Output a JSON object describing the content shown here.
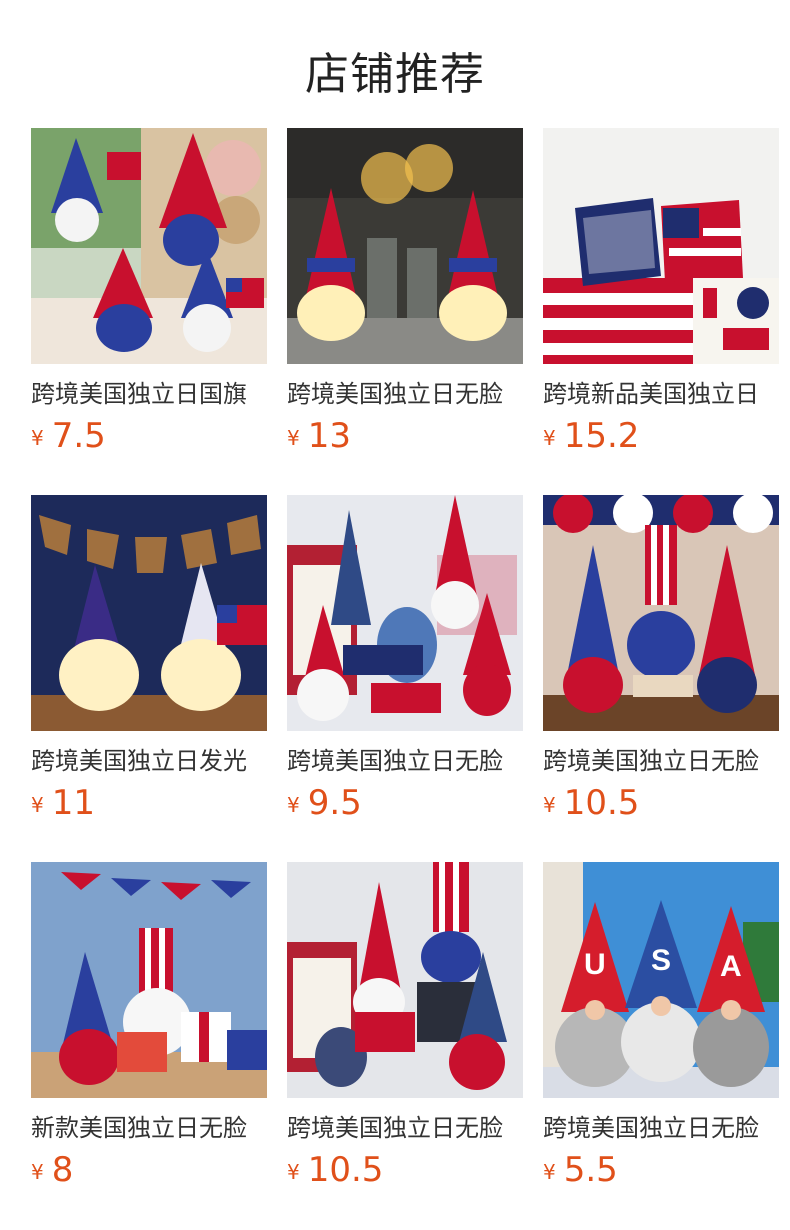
{
  "header": {
    "title": "店铺推荐"
  },
  "products": [
    {
      "name": "跨境美国独立日国旗",
      "currency": "¥",
      "price": "7.5"
    },
    {
      "name": "跨境美国独立日无脸",
      "currency": "¥",
      "price": "13"
    },
    {
      "name": "跨境新品美国独立日",
      "currency": "¥",
      "price": "15.2"
    },
    {
      "name": "跨境美国独立日发光",
      "currency": "¥",
      "price": "11"
    },
    {
      "name": "跨境美国独立日无脸",
      "currency": "¥",
      "price": "9.5"
    },
    {
      "name": "跨境美国独立日无脸",
      "currency": "¥",
      "price": "10.5"
    },
    {
      "name": "新款美国独立日无脸",
      "currency": "¥",
      "price": "8"
    },
    {
      "name": "跨境美国独立日无脸",
      "currency": "¥",
      "price": "10.5"
    },
    {
      "name": "跨境美国独立日无脸",
      "currency": "¥",
      "price": "5.5"
    }
  ],
  "images": [
    "patriotic-gnomes-photo",
    "light-up-gnomes-photo",
    "flag-pillows-photo",
    "glowing-gnomes-usa-banner-photo",
    "gnomes-god-bless-america-photo",
    "gnomes-bunting-photo",
    "gnome-gifts-photo",
    "gnomes-flag-sign-photo",
    "usa-letter-gnomes-photo"
  ],
  "colors": {
    "price": "#e0501a",
    "red": "#c8102e",
    "blue": "#2a3f9e"
  }
}
